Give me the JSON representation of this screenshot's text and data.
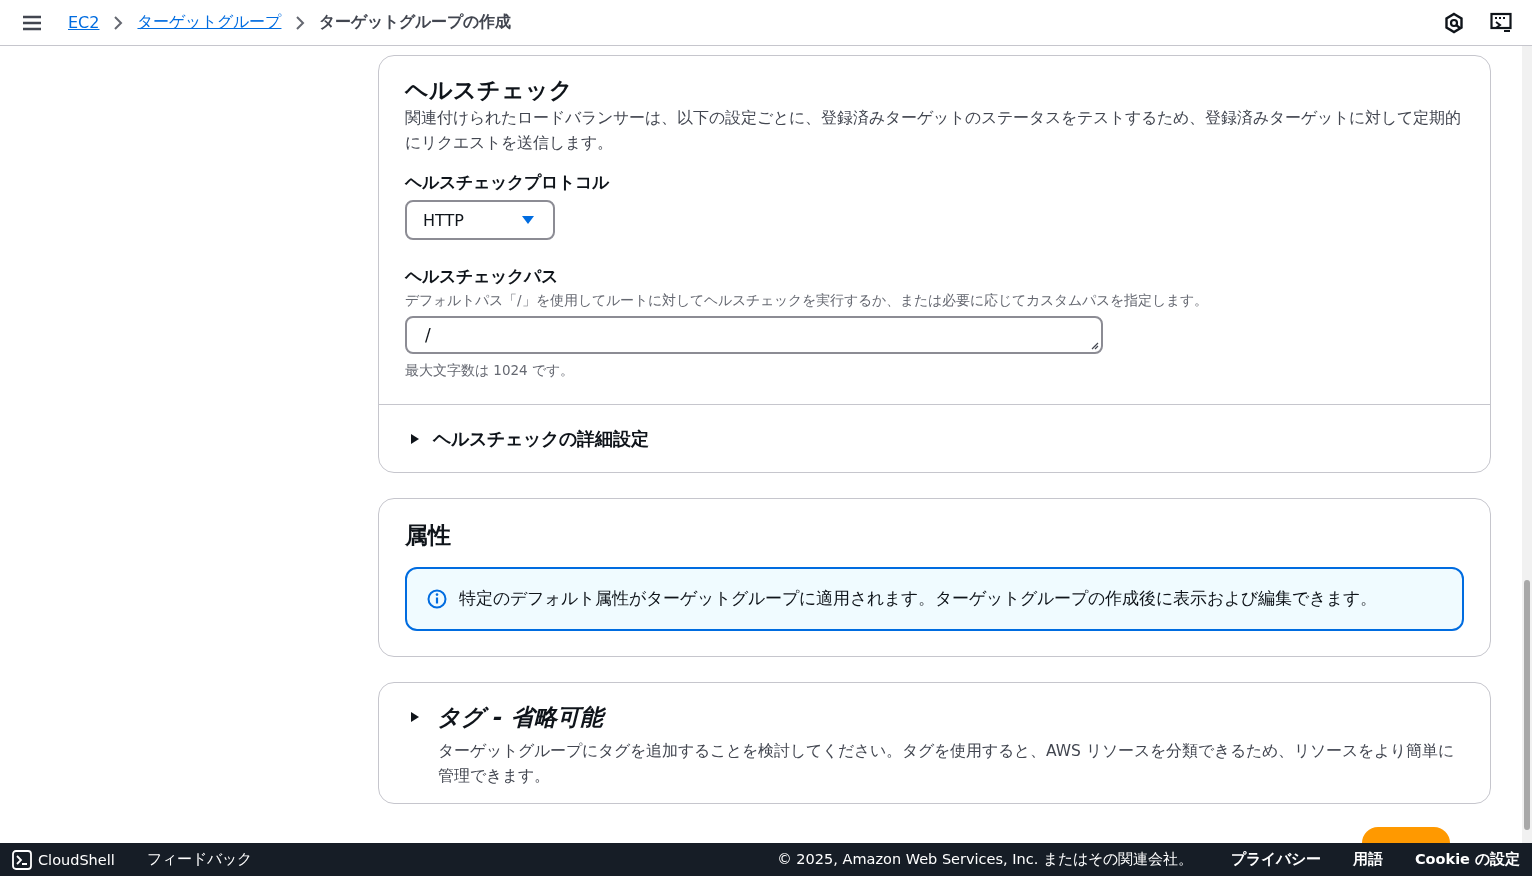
{
  "header": {
    "breadcrumbs": [
      {
        "label": "EC2",
        "link": true
      },
      {
        "label": "ターゲットグループ",
        "link": true
      },
      {
        "label": "ターゲットグループの作成",
        "link": false
      }
    ]
  },
  "health_check": {
    "title": "ヘルスチェック",
    "description": "関連付けられたロードバランサーは、以下の設定ごとに、登録済みターゲットのステータスをテストするため、登録済みターゲットに対して定期的にリクエストを送信します。",
    "protocol": {
      "label": "ヘルスチェックプロトコル",
      "value": "HTTP"
    },
    "path": {
      "label": "ヘルスチェックパス",
      "hint": "デフォルトパス「/」を使用してルートに対してヘルスチェックを実行するか、または必要に応じてカスタムパスを指定します。",
      "value": "/",
      "constraint": "最大文字数は 1024 です。"
    },
    "advanced": {
      "label": "ヘルスチェックの詳細設定",
      "expanded": false
    }
  },
  "attributes": {
    "title": "属性",
    "info": "特定のデフォルト属性がターゲットグループに適用されます。ターゲットグループの作成後に表示および編集できます。"
  },
  "tags": {
    "title": "タグ - 省略可能",
    "expanded": false,
    "description": "ターゲットグループにタグを追加することを検討してください。タグを使用すると、AWS リソースを分類できるため、リソースをより簡単に管理できます。"
  },
  "footer": {
    "cloudshell": "CloudShell",
    "feedback": "フィードバック",
    "copyright": "© 2025, Amazon Web Services, Inc. またはその関連会社。",
    "links": [
      "プライバシー",
      "用語",
      "Cookie の設定"
    ]
  }
}
